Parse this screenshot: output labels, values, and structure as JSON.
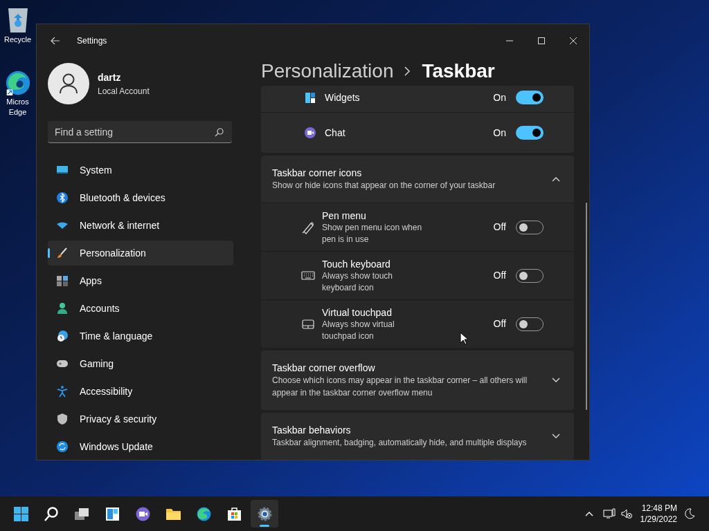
{
  "desktop_icons": [
    {
      "lines": [
        "Recycle"
      ]
    },
    {
      "lines": [
        "Micros",
        "Edge"
      ]
    }
  ],
  "window": {
    "title": "Settings"
  },
  "user": {
    "name": "dartz",
    "account": "Local Account"
  },
  "search": {
    "placeholder": "Find a setting"
  },
  "nav_items": [
    {
      "label": "System",
      "selected": false
    },
    {
      "label": "Bluetooth & devices",
      "selected": false
    },
    {
      "label": "Network & internet",
      "selected": false
    },
    {
      "label": "Personalization",
      "selected": true
    },
    {
      "label": "Apps",
      "selected": false
    },
    {
      "label": "Accounts",
      "selected": false
    },
    {
      "label": "Time & language",
      "selected": false
    },
    {
      "label": "Gaming",
      "selected": false
    },
    {
      "label": "Accessibility",
      "selected": false
    },
    {
      "label": "Privacy & security",
      "selected": false
    },
    {
      "label": "Windows Update",
      "selected": false
    }
  ],
  "breadcrumb": [
    "Personalization",
    "Taskbar"
  ],
  "taskbar_items_rows": [
    {
      "label": "Widgets",
      "state_label": "On",
      "on": true
    },
    {
      "label": "Chat",
      "state_label": "On",
      "on": true
    }
  ],
  "sections": [
    {
      "title": "Taskbar corner icons",
      "description": "Show or hide icons that appear on the corner of your taskbar",
      "expanded": true,
      "rows": [
        {
          "label": "Pen menu",
          "description": "Show pen menu icon when pen is in use",
          "state_label": "Off",
          "on": false
        },
        {
          "label": "Touch keyboard",
          "description": "Always show touch keyboard icon",
          "state_label": "Off",
          "on": false
        },
        {
          "label": "Virtual touchpad",
          "description": "Always show virtual touchpad icon",
          "state_label": "Off",
          "on": false
        }
      ]
    },
    {
      "title": "Taskbar corner overflow",
      "description": "Choose which icons may appear in the taskbar corner – all others will appear in the taskbar corner overflow menu",
      "expanded": false
    },
    {
      "title": "Taskbar behaviors",
      "description": "Taskbar alignment, badging, automatically hide, and multiple displays",
      "expanded": false
    }
  ],
  "taskbar": {
    "apps": [
      {
        "selected": false
      },
      {
        "selected": false
      },
      {
        "selected": false
      },
      {
        "selected": false
      },
      {
        "selected": false
      },
      {
        "selected": false
      },
      {
        "selected": false
      },
      {
        "selected": false
      },
      {
        "selected": true
      }
    ],
    "time": "12:48 PM",
    "date": "1/29/2022"
  }
}
